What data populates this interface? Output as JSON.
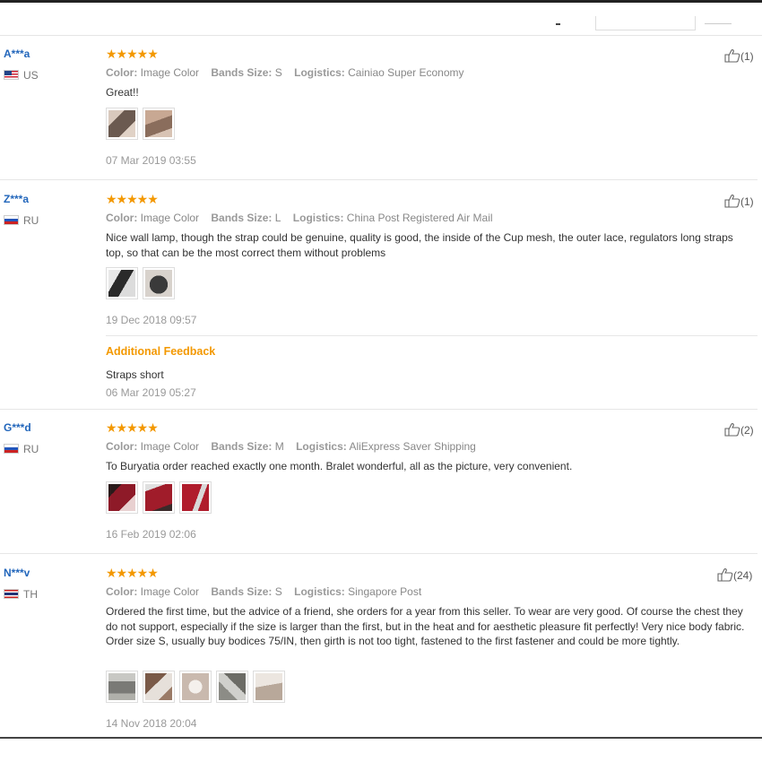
{
  "reviews": [
    {
      "user": "A***a",
      "country": "US",
      "stars": "★★★★★",
      "color_label": "Color:",
      "color_value": "Image Color",
      "size_label": "Bands Size:",
      "size_value": "S",
      "logistics_label": "Logistics:",
      "logistics_value": "Cainiao Super Economy",
      "text": "Great!!",
      "date": "07 Mar 2019 03:55",
      "helpful": "(1)",
      "photos": [
        "#6b5a50",
        "#8a6d5c"
      ]
    },
    {
      "user": "Z***a",
      "country": "RU",
      "stars": "★★★★★",
      "color_label": "Color:",
      "color_value": "Image Color",
      "size_label": "Bands Size:",
      "size_value": "L",
      "logistics_label": "Logistics:",
      "logistics_value": "China Post Registered Air Mail",
      "text": "Nice wall lamp, though the strap could be genuine, quality is good, the inside of the Cup mesh, the outer lace, regulators long straps top, so that can be the most correct them without problems",
      "date": "19 Dec 2018 09:57",
      "helpful": "(1)",
      "photos": [
        "#2a2a2a",
        "#3a3a3a"
      ],
      "additional": {
        "title": "Additional Feedback",
        "text": "Straps short",
        "date": "06 Mar 2019 05:27"
      }
    },
    {
      "user": "G***d",
      "country": "RU",
      "stars": "★★★★★",
      "color_label": "Color:",
      "color_value": "Image Color",
      "size_label": "Bands Size:",
      "size_value": "M",
      "logistics_label": "Logistics:",
      "logistics_value": "AliExpress Saver Shipping",
      "text": "To Buryatia order reached exactly one month. Bralet wonderful, all as the picture, very convenient.",
      "date": "16 Feb 2019 02:06",
      "helpful": "(2)",
      "photos": [
        "#8e1a28",
        "#a01c2a",
        "#b01c2c"
      ]
    },
    {
      "user": "N***v",
      "country": "TH",
      "stars": "★★★★★",
      "color_label": "Color:",
      "color_value": "Image Color",
      "size_label": "Bands Size:",
      "size_value": "S",
      "logistics_label": "Logistics:",
      "logistics_value": "Singapore Post",
      "text": "Ordered the first time, but the advice of a friend, she orders for a year from this seller. To wear are very good. Of course the chest they do not support, especially if the size is larger than the first, but in the heat and for aesthetic pleasure fit perfectly! Very nice body fabric. Order size S, usually buy bodices 75/IN, then girth is not too tight, fastened to the first fastener and could be more tightly.",
      "date": "14 Nov 2018 20:04",
      "helpful": "(24)",
      "photos": [
        "#9a9a94",
        "#7a5a48",
        "#c9b9ae",
        "#8c8c86",
        "#b8a89a"
      ]
    }
  ],
  "colors": {
    "accent": "#f39800",
    "link": "#2266bb"
  },
  "icons": {
    "helpful": "thumbs-up-icon"
  }
}
